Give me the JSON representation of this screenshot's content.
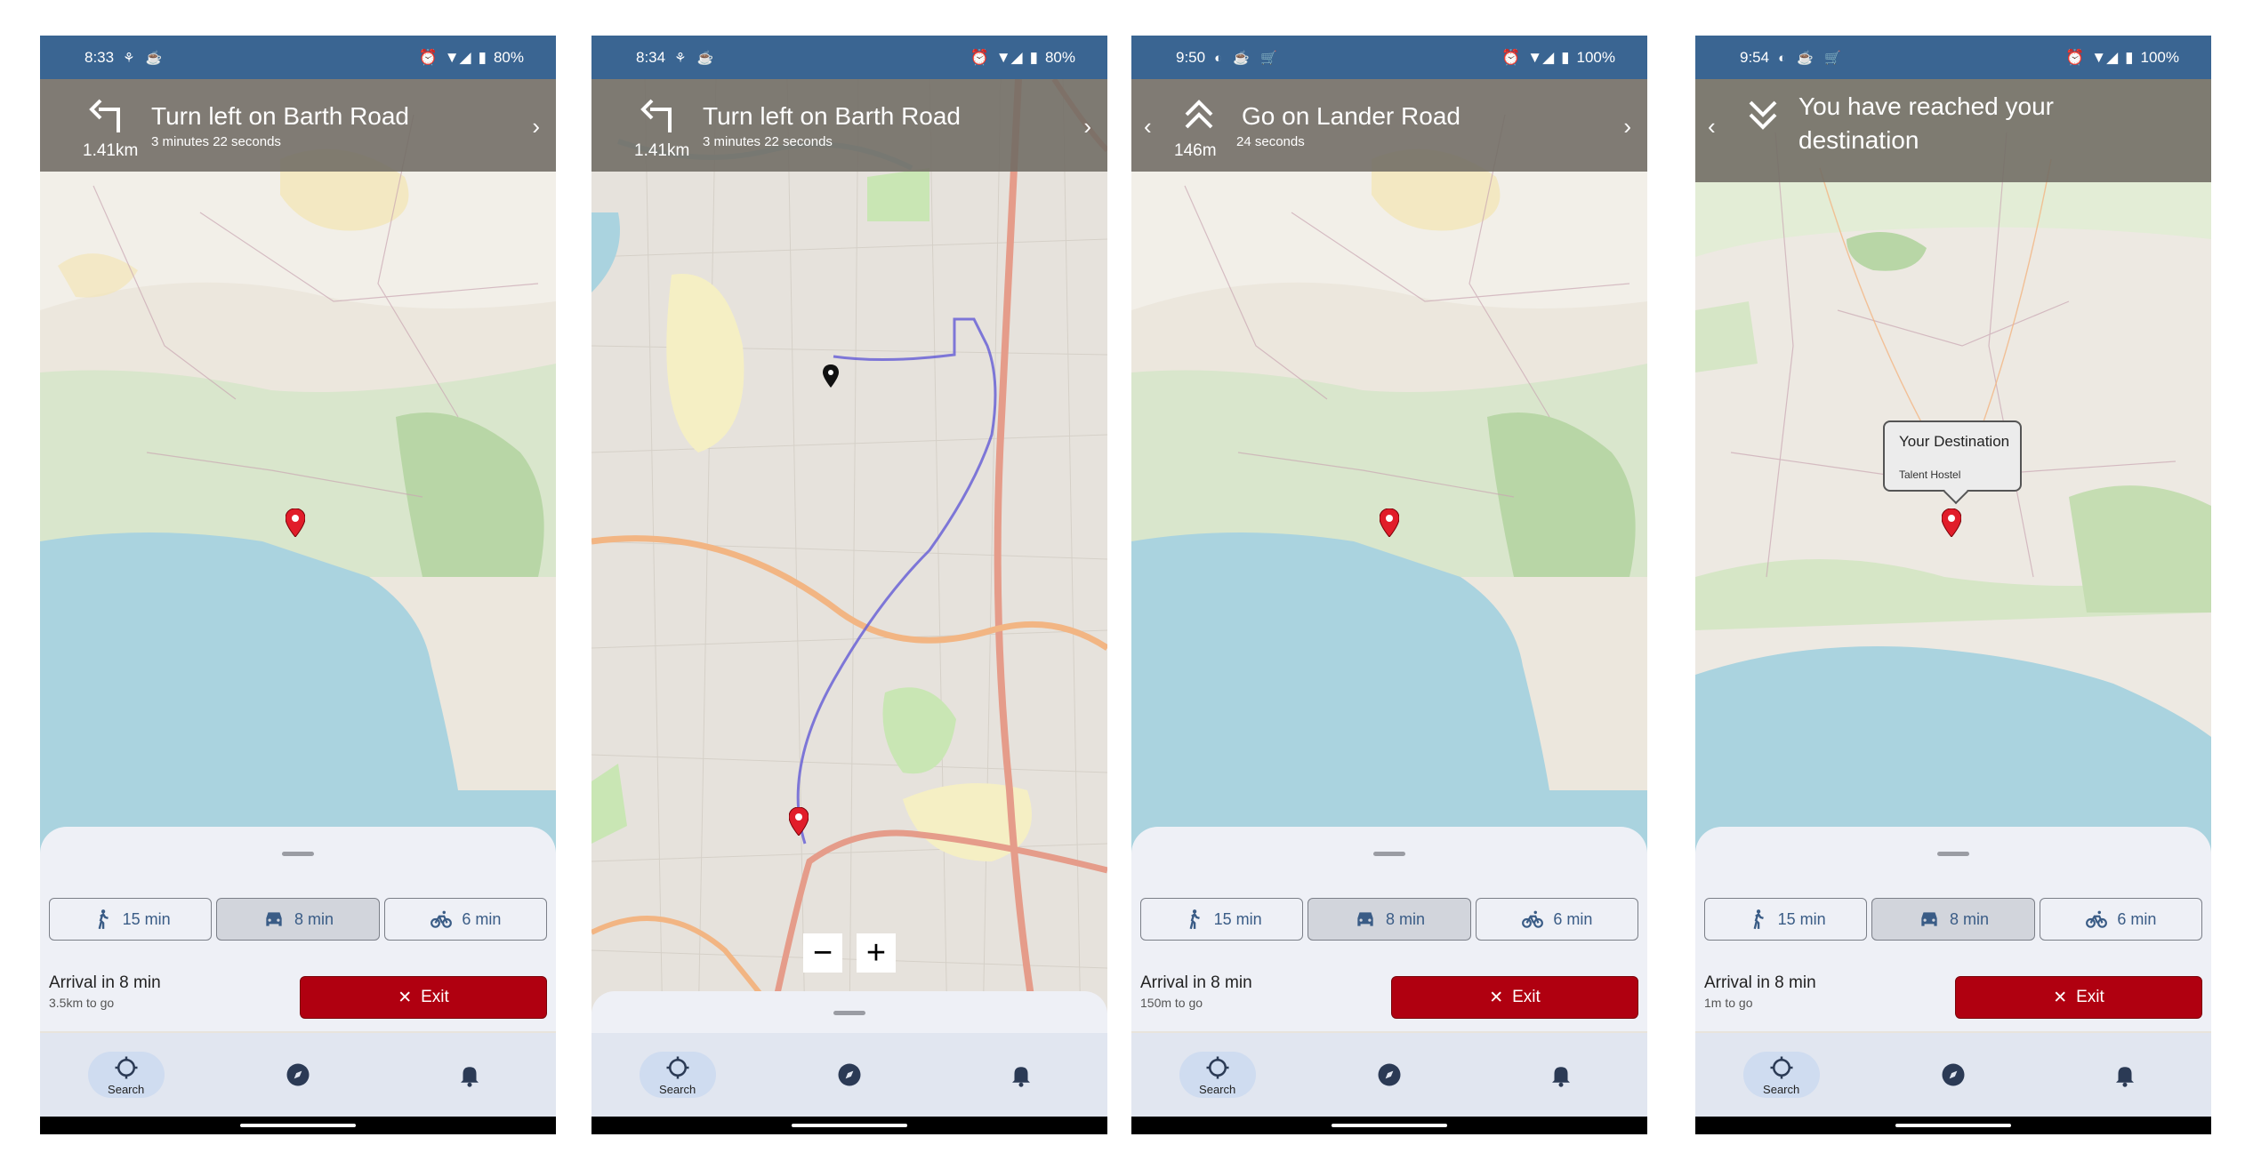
{
  "colors": {
    "statusbar": "#3a6592",
    "exit": "#b00010",
    "accent": "#3a5c86"
  },
  "modes": {
    "walk": "15 min",
    "drive": "8 min",
    "bike": "6 min"
  },
  "exit_label": "Exit",
  "nav_search": "Search",
  "screens": [
    {
      "time": "8:33",
      "battery": "80%",
      "instruction": "Turn left  on Barth Road",
      "distance": "1.41km",
      "duration": "3 minutes 22 seconds",
      "arrival": "Arrival in 8 min",
      "remaining": "3.5km to go"
    },
    {
      "time": "8:34",
      "battery": "80%",
      "instruction": "Turn left  on Barth Road",
      "distance": "1.41km",
      "duration": "3 minutes 22 seconds"
    },
    {
      "time": "9:50",
      "battery": "100%",
      "instruction": "Go on Lander Road",
      "distance": "146m",
      "duration": "24 seconds",
      "arrival": "Arrival in 8 min",
      "remaining": "150m to go"
    },
    {
      "time": "9:54",
      "battery": "100%",
      "instruction": "You have reached your destination",
      "arrival": "Arrival in 8 min",
      "remaining": "1m to go",
      "popup_title": "Your Destination",
      "popup_subtitle": "Talent Hostel"
    }
  ]
}
